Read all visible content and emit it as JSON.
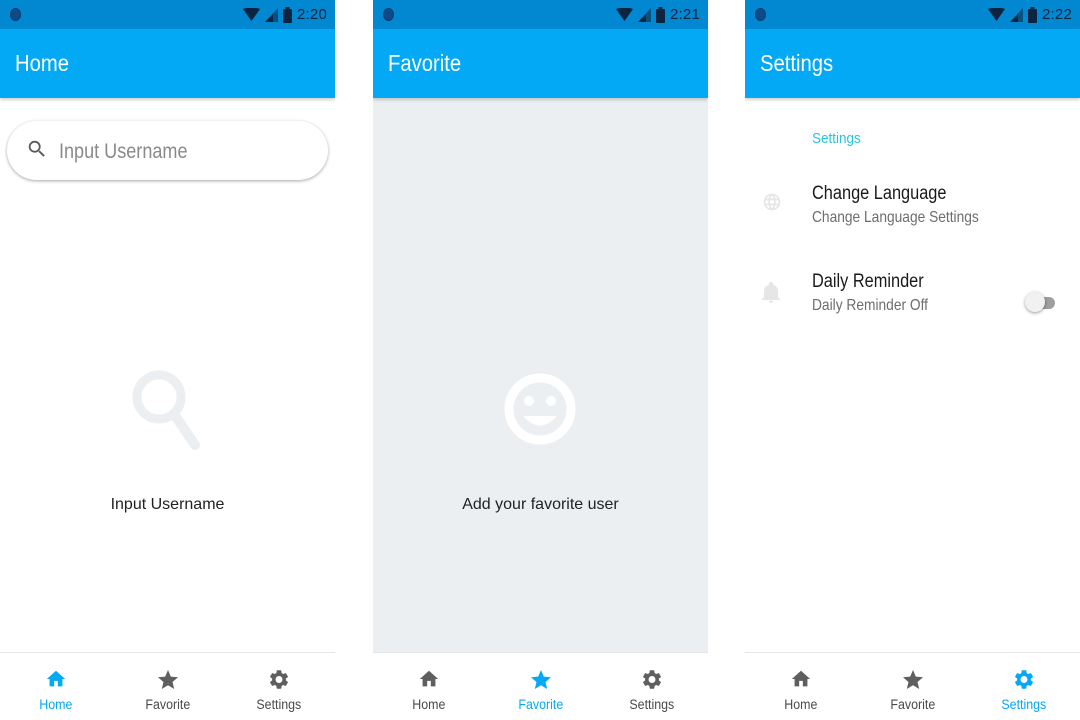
{
  "colors": {
    "status_bar": "#0288d1",
    "app_bar": "#03a9f4",
    "accent": "#03a9f4",
    "section_header": "#26c6da",
    "favorite_bg": "#eceff1",
    "nav_inactive": "#5f5f5f"
  },
  "nav": {
    "home_label": "Home",
    "favorite_label": "Favorite",
    "settings_label": "Settings"
  },
  "screens": {
    "home": {
      "time": "2:20",
      "title": "Home",
      "search_placeholder": "Input Username",
      "empty_icon": "search-icon",
      "empty_text": "Input Username",
      "active_tab": "Home"
    },
    "favorite": {
      "time": "2:21",
      "title": "Favorite",
      "empty_icon": "smiley-icon",
      "empty_text": "Add your favorite user",
      "active_tab": "Favorite"
    },
    "settings": {
      "time": "2:22",
      "title": "Settings",
      "section_header": "Settings",
      "items": [
        {
          "icon": "globe-icon",
          "title": "Change Language",
          "summary": "Change Language Settings"
        },
        {
          "icon": "bell-icon",
          "title": "Daily Reminder",
          "summary": "Daily Reminder Off",
          "toggle_on": false
        }
      ],
      "active_tab": "Settings"
    }
  }
}
